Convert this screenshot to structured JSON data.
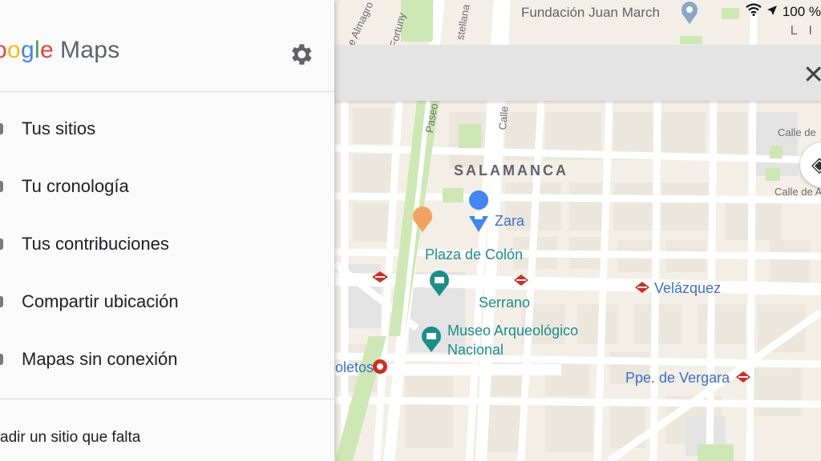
{
  "status_bar": {
    "place": "Fundación Juan March",
    "battery": "100 %",
    "corner_text": "L I"
  },
  "drawer": {
    "logo_part": "oogle",
    "logo_product": "Maps",
    "menu": [
      {
        "label": "Tus sitios"
      },
      {
        "label": "Tu cronología"
      },
      {
        "label": "Tus contribuciones"
      },
      {
        "label": "Compartir ubicación"
      },
      {
        "label": "Mapas sin conexión"
      }
    ],
    "add_place": "adir un sitio que falta"
  },
  "map": {
    "district": "SALAMANCA",
    "places": {
      "zara": "Zara",
      "plaza_colon": "Plaza de Colón",
      "serrano": "Serrano",
      "museo_line1": "Museo Arqueológico",
      "museo_line2": "Nacional",
      "velazquez": "Velázquez",
      "recoletos": "oletos",
      "vergara": "Ppe. de Vergara"
    },
    "streets": {
      "almagro": "e Almagro",
      "castellana": "stellana",
      "fortuny": "Fortuny",
      "paseo": "Paseo",
      "calle": "Calle",
      "calle_de1": "Calle de",
      "calle_de2": "Calle de A"
    }
  },
  "colors": {
    "map_bg": "#f3efe6",
    "block": "#ebe7dd",
    "block_gray": "#e3e3e3",
    "road": "#ffffff",
    "park": "#cde8b4",
    "accent_blue": "#4285f4",
    "metro_red": "#d42b1e"
  },
  "icons": [
    "settings-gear-icon",
    "close-icon",
    "layers-icon",
    "wifi-icon",
    "location-arrow-icon",
    "metro-icon",
    "shopping-bag-icon",
    "restaurant-icon",
    "camera-icon",
    "museum-icon",
    "pin-icon"
  ]
}
